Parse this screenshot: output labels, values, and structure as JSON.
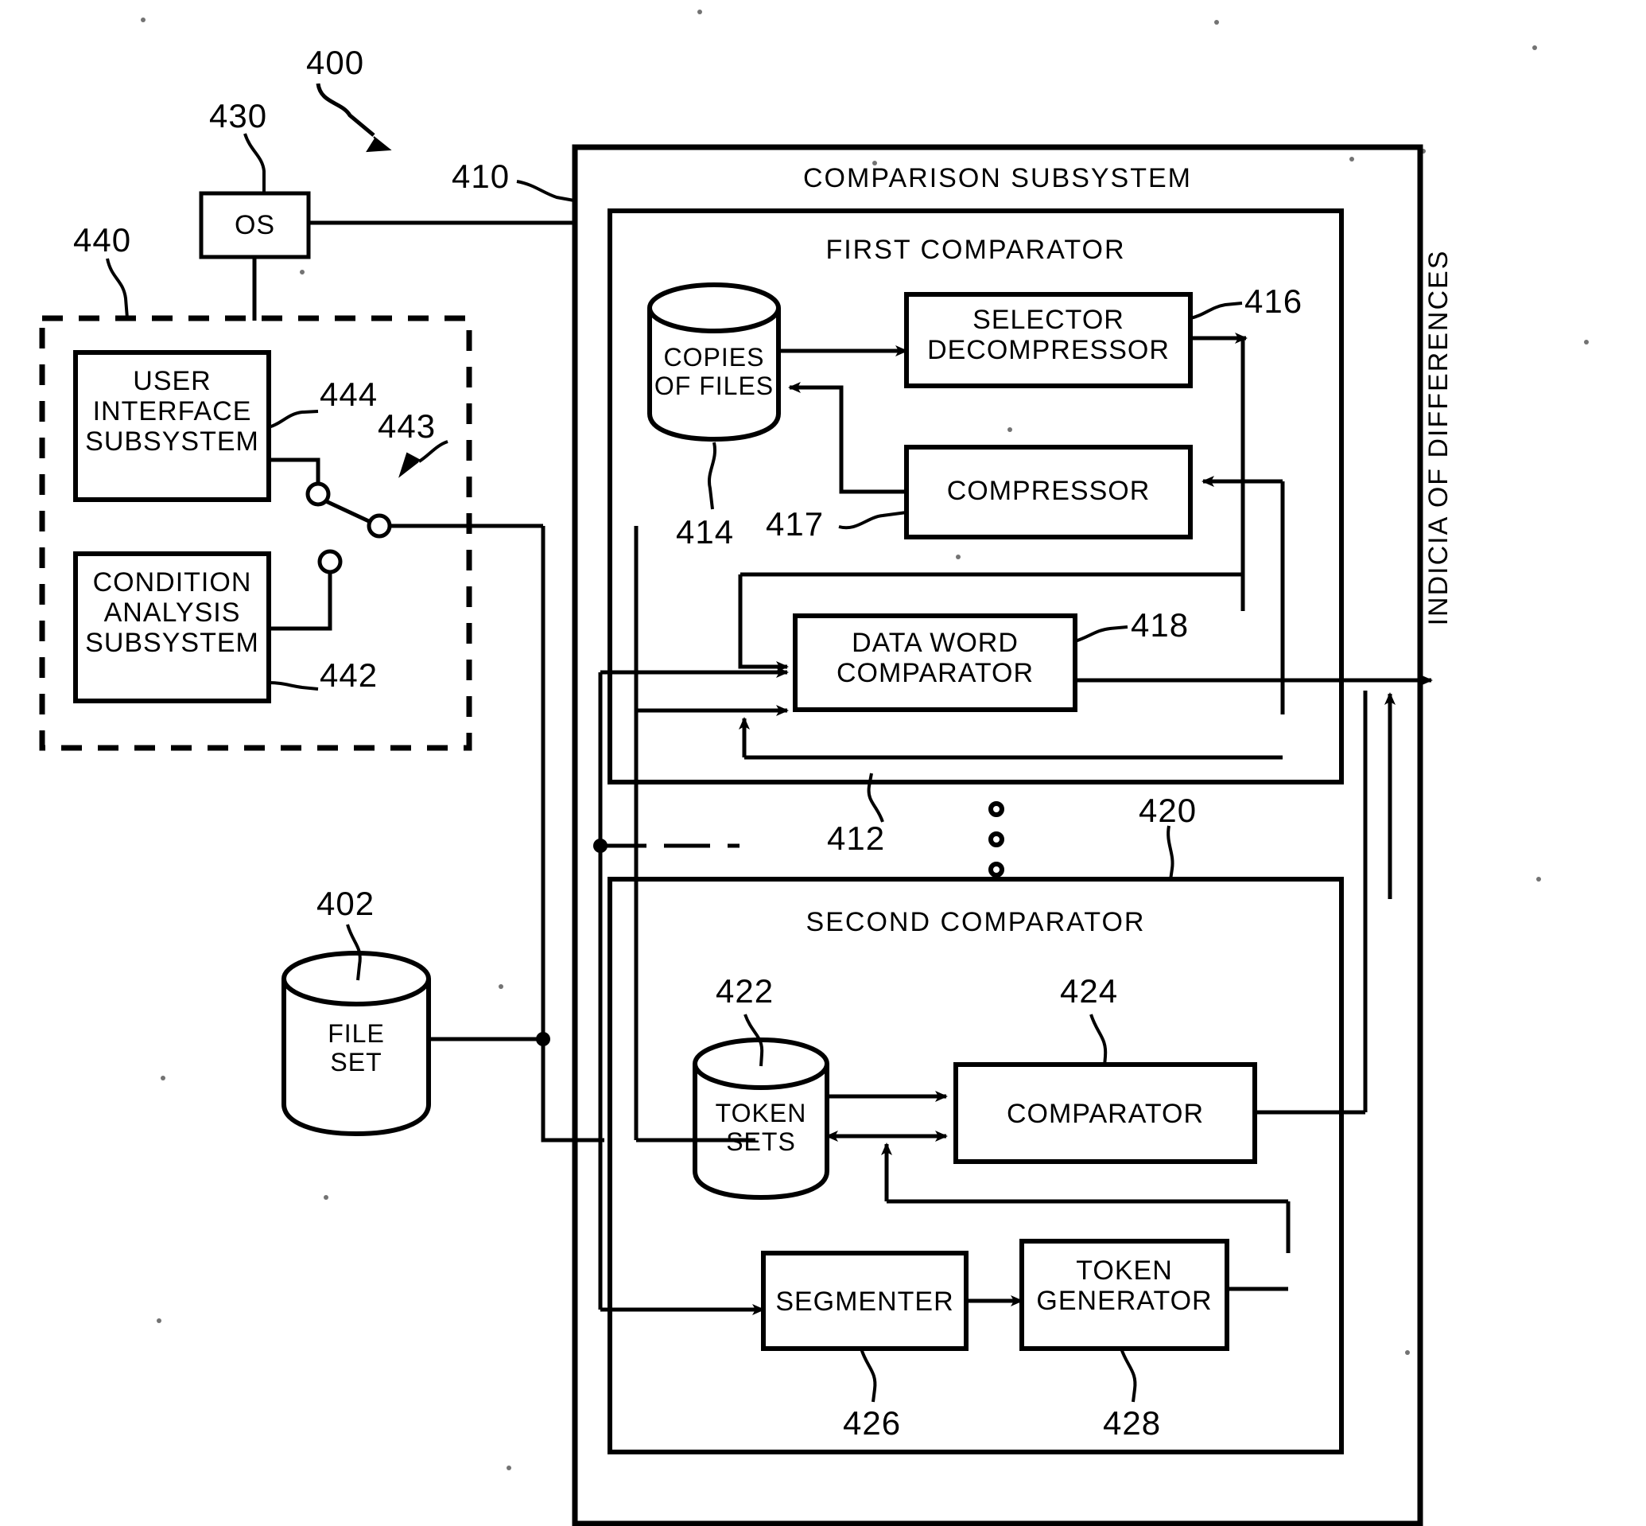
{
  "figure": {
    "number": "400",
    "title_text": "COMPARISON SUBSYSTEM"
  },
  "reference_numerals": {
    "system": "400",
    "comparison_subsystem": "410",
    "first_comparator": "412",
    "copies_of_files": "414",
    "selector_decompressor": "416",
    "compressor": "417",
    "data_word_comparator": "418",
    "second_comparator": "420",
    "token_sets": "422",
    "comparator": "424",
    "segmenter": "426",
    "token_generator": "428",
    "os": "430",
    "user_group": "440",
    "condition_analysis_subsystem": "442",
    "switch": "443",
    "user_interface_subsystem": "444",
    "file_set": "402"
  },
  "blocks": {
    "os": "OS",
    "user_interface_subsystem": "USER\nINTERFACE\nSUBSYSTEM",
    "condition_analysis_subsystem": "CONDITION\nANALYSIS\nSUBSYSTEM",
    "file_set": "FILE\nSET",
    "comparison_subsystem": "COMPARISON SUBSYSTEM",
    "first_comparator": "FIRST COMPARATOR",
    "copies_of_files": "COPIES\nOF FILES",
    "selector_decompressor": "SELECTOR\nDECOMPRESSOR",
    "compressor": "COMPRESSOR",
    "data_word_comparator": "DATA WORD\nCOMPARATOR",
    "second_comparator": "SECOND COMPARATOR",
    "token_sets": "TOKEN\nSETS",
    "comparator": "COMPARATOR",
    "segmenter": "SEGMENTER",
    "token_generator": "TOKEN\nGENERATOR"
  },
  "output": {
    "indicia_label": "INDICIA OF DIFFERENCES"
  },
  "colors": {
    "line": "#000000",
    "background": "#ffffff"
  }
}
